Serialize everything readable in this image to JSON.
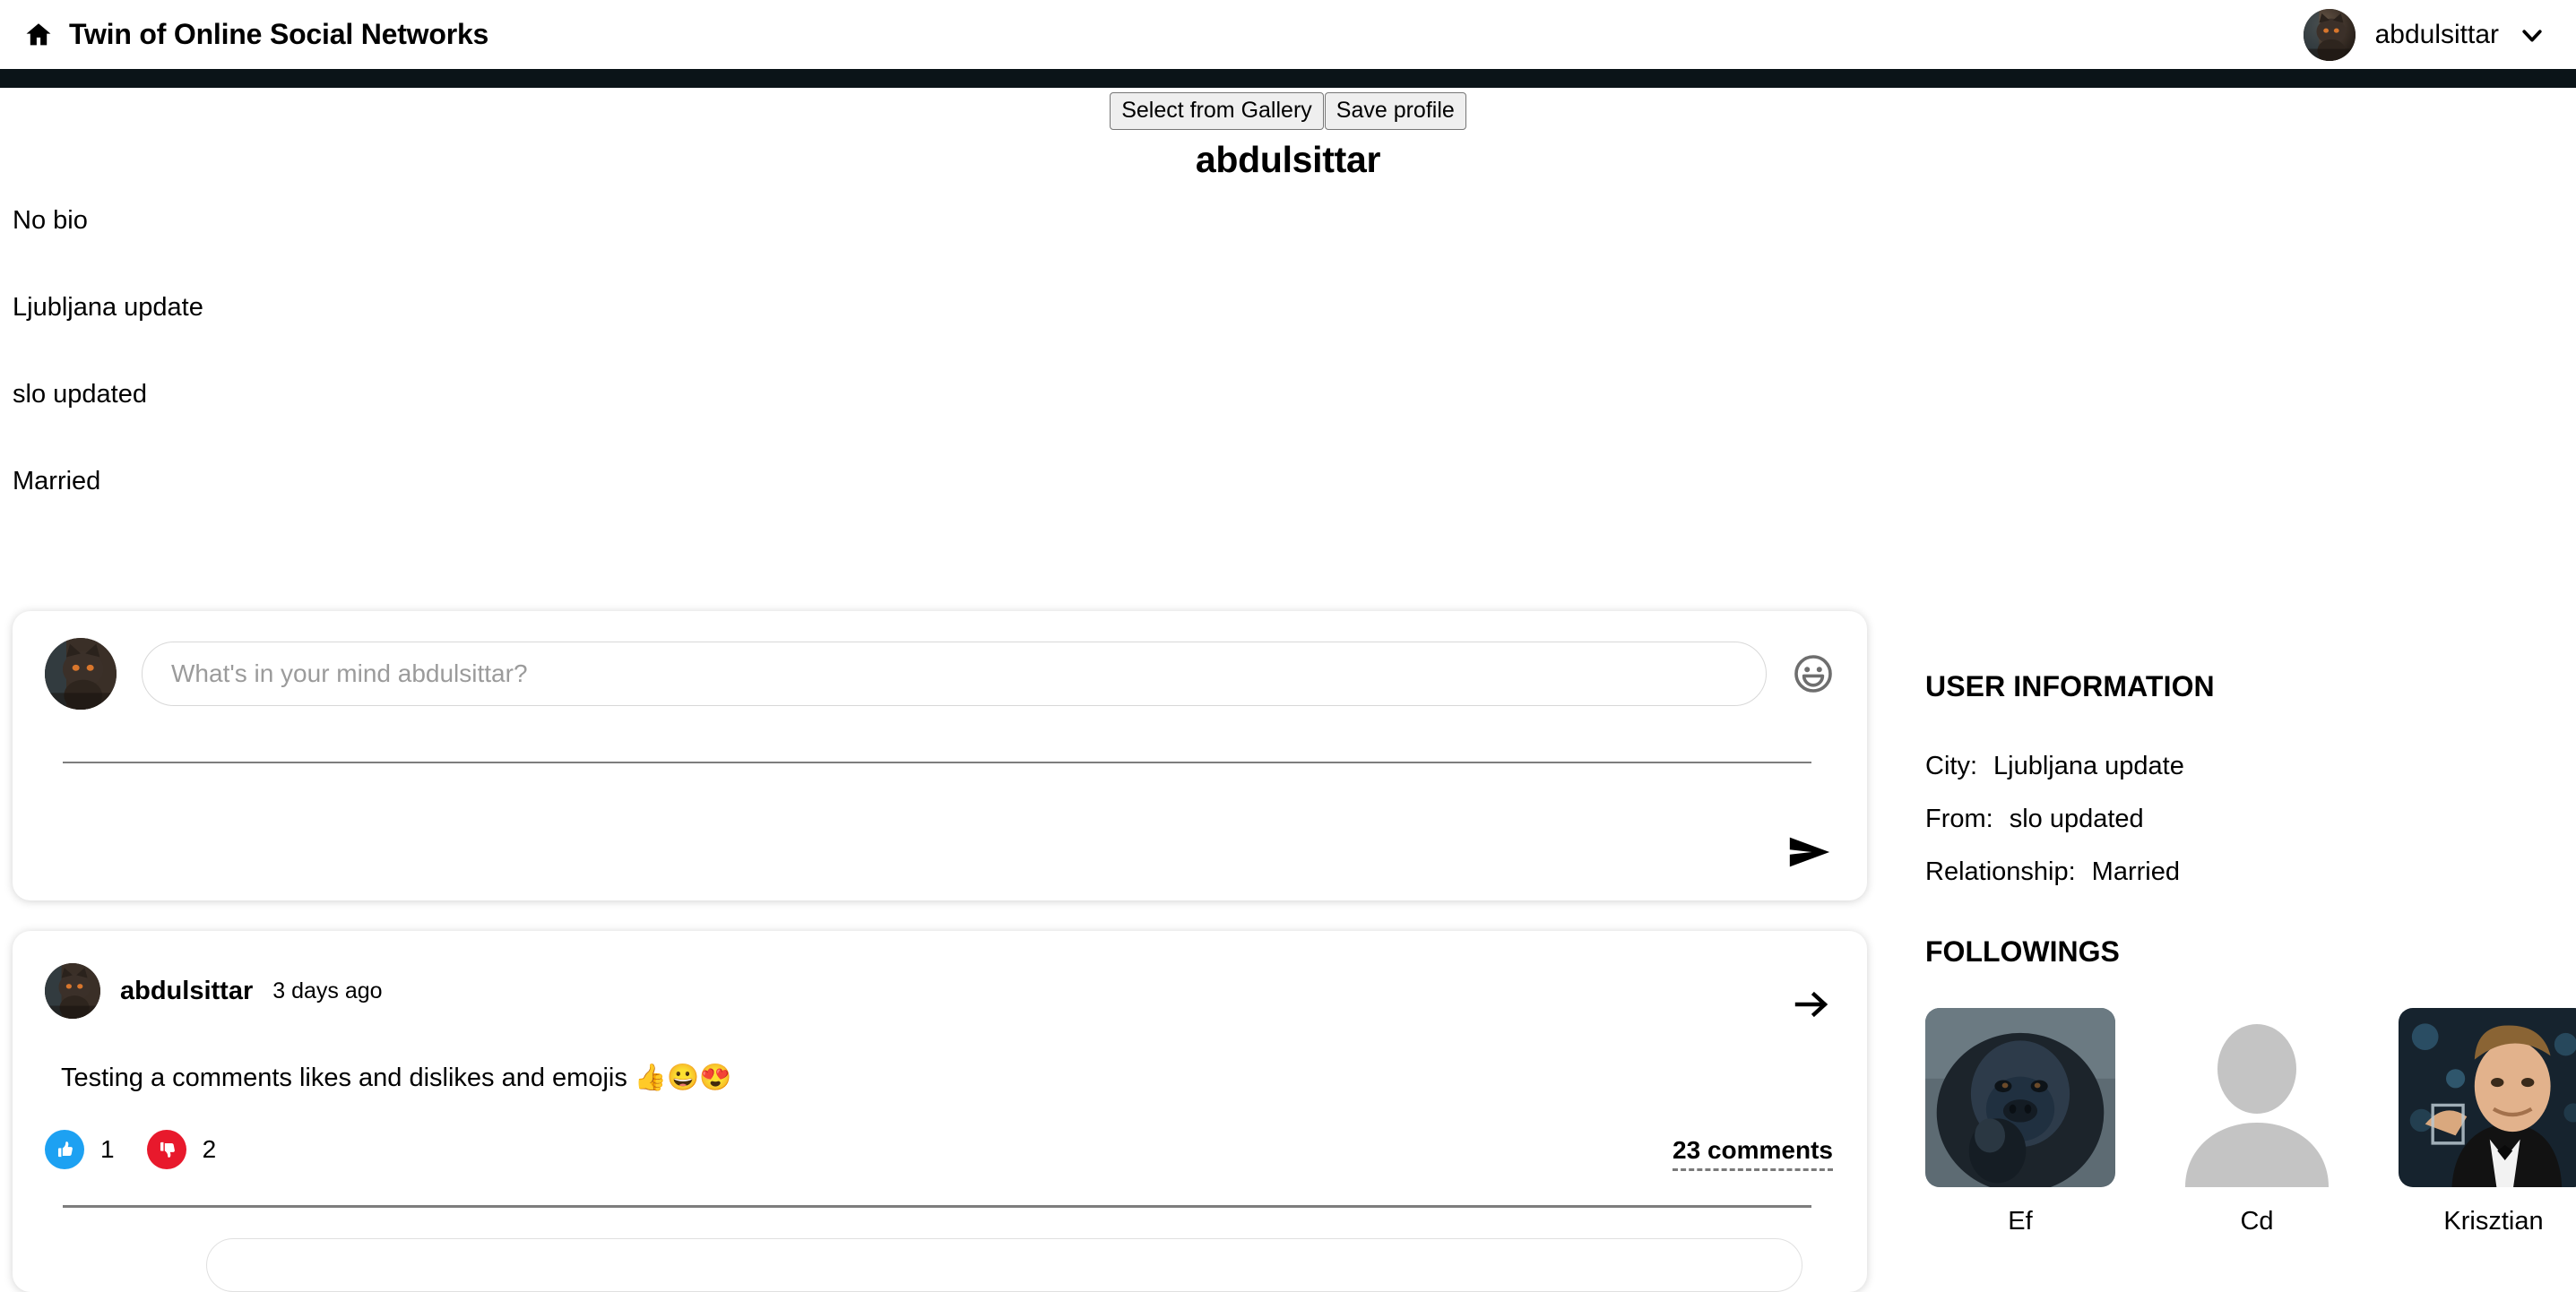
{
  "header": {
    "home_icon": "home-icon",
    "title": "Twin of Online Social Networks",
    "user_name": "abdulsittar",
    "chevron_icon": "chevron-down-icon",
    "avatar_alt": "abdulsittar-avatar"
  },
  "profile": {
    "select_gallery_label": "Select from Gallery",
    "save_profile_label": "Save profile",
    "display_name": "abdulsittar",
    "bio_lines": [
      "No bio",
      "Ljubljana update",
      "slo updated",
      "Married"
    ]
  },
  "composer": {
    "placeholder": "What's in your mind abdulsittar?",
    "value": "",
    "emoji_icon": "smiley-face-icon",
    "send_icon": "send-icon"
  },
  "post": {
    "author": "abdulsittar",
    "timestamp": "3 days ago",
    "text": "Testing a comments likes and dislikes and emojis 👍😀😍",
    "arrow_icon": "arrow-right-icon",
    "like_icon": "thumbs-up-icon",
    "like_count": "1",
    "dislike_icon": "thumbs-down-icon",
    "dislike_count": "2",
    "comments_label": "23 comments",
    "like_color": "#1DA1F2",
    "dislike_color": "#E8192C"
  },
  "sidebar": {
    "user_information_title": "USER INFORMATION",
    "info": [
      {
        "label": "City:",
        "value": "Ljubljana update"
      },
      {
        "label": "From:",
        "value": "slo updated"
      },
      {
        "label": "Relationship:",
        "value": "Married"
      }
    ],
    "followings_title": "FOLLOWINGS",
    "followings": [
      {
        "name": "Ef",
        "avatar": "gorilla-photo"
      },
      {
        "name": "Cd",
        "avatar": "default-person-icon"
      },
      {
        "name": "Krisztian",
        "avatar": "man-photo"
      }
    ]
  }
}
